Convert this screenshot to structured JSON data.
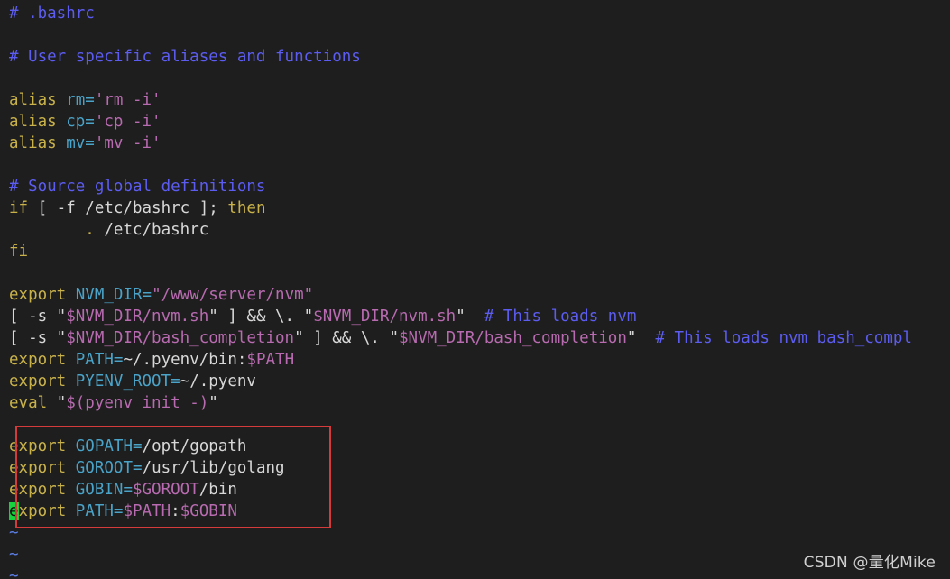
{
  "colors": {
    "background": "#1e1e1e",
    "comment": "#5c5cf0",
    "keyword": "#c9b24a",
    "variable": "#4aa3c8",
    "string": "#b86bb0",
    "text": "#d8d8d8",
    "tilde": "#5c7fe8",
    "cursor": "#18d23d",
    "highlight_box": "#d63b3b"
  },
  "editor": {
    "lines": [
      [
        {
          "t": "# .bashrc",
          "c": "comment"
        }
      ],
      [],
      [
        {
          "t": "# User specific aliases and functions",
          "c": "comment"
        }
      ],
      [],
      [
        {
          "t": "alias",
          "c": "keyword"
        },
        {
          "t": " "
        },
        {
          "t": "rm=",
          "c": "variable"
        },
        {
          "t": "'rm -i'",
          "c": "string"
        }
      ],
      [
        {
          "t": "alias",
          "c": "keyword"
        },
        {
          "t": " "
        },
        {
          "t": "cp=",
          "c": "variable"
        },
        {
          "t": "'cp -i'",
          "c": "string"
        }
      ],
      [
        {
          "t": "alias",
          "c": "keyword"
        },
        {
          "t": " "
        },
        {
          "t": "mv=",
          "c": "variable"
        },
        {
          "t": "'mv -i'",
          "c": "string"
        }
      ],
      [],
      [
        {
          "t": "# Source global definitions",
          "c": "comment"
        }
      ],
      [
        {
          "t": "if",
          "c": "keyword"
        },
        {
          "t": " [ -f /etc/bashrc ]; "
        },
        {
          "t": "then",
          "c": "keyword"
        }
      ],
      [
        {
          "t": "        "
        },
        {
          "t": ".",
          "c": "keyword"
        },
        {
          "t": " /etc/bashrc"
        }
      ],
      [
        {
          "t": "fi",
          "c": "keyword"
        }
      ],
      [],
      [
        {
          "t": "export",
          "c": "keyword"
        },
        {
          "t": " "
        },
        {
          "t": "NVM_DIR=",
          "c": "variable"
        },
        {
          "t": "\"/www/server/nvm\"",
          "c": "string"
        }
      ],
      [
        {
          "t": "[ -s \""
        },
        {
          "t": "$NVM_DIR/nvm.sh",
          "c": "string"
        },
        {
          "t": "\" ] && \\. \""
        },
        {
          "t": "$NVM_DIR/nvm.sh",
          "c": "string"
        },
        {
          "t": "\"  "
        },
        {
          "t": "# This loads nvm",
          "c": "comment"
        }
      ],
      [
        {
          "t": "[ -s \""
        },
        {
          "t": "$NVM_DIR/bash_completion",
          "c": "string"
        },
        {
          "t": "\" ] && \\. \""
        },
        {
          "t": "$NVM_DIR/bash_completion",
          "c": "string"
        },
        {
          "t": "\"  "
        },
        {
          "t": "# This loads nvm bash_compl",
          "c": "comment"
        }
      ],
      [
        {
          "t": "export",
          "c": "keyword"
        },
        {
          "t": " "
        },
        {
          "t": "PATH=",
          "c": "variable"
        },
        {
          "t": "~/.pyenv/bin:"
        },
        {
          "t": "$PATH",
          "c": "string"
        }
      ],
      [
        {
          "t": "export",
          "c": "keyword"
        },
        {
          "t": " "
        },
        {
          "t": "PYENV_ROOT=",
          "c": "variable"
        },
        {
          "t": "~/.pyenv"
        }
      ],
      [
        {
          "t": "eval",
          "c": "keyword"
        },
        {
          "t": " \""
        },
        {
          "t": "$(pyenv init -)",
          "c": "string"
        },
        {
          "t": "\""
        }
      ],
      [],
      [
        {
          "t": "export",
          "c": "keyword"
        },
        {
          "t": " "
        },
        {
          "t": "GOPATH=",
          "c": "variable"
        },
        {
          "t": "/opt/gopath"
        }
      ],
      [
        {
          "t": "export",
          "c": "keyword"
        },
        {
          "t": " "
        },
        {
          "t": "GOROOT=",
          "c": "variable"
        },
        {
          "t": "/usr/lib/golang"
        }
      ],
      [
        {
          "t": "export",
          "c": "keyword"
        },
        {
          "t": " "
        },
        {
          "t": "GOBIN=",
          "c": "variable"
        },
        {
          "t": "$GOROOT",
          "c": "string"
        },
        {
          "t": "/bin"
        }
      ],
      [
        {
          "t": "e",
          "c": "cursor"
        },
        {
          "t": "xport",
          "c": "keyword"
        },
        {
          "t": " "
        },
        {
          "t": "PATH=",
          "c": "variable"
        },
        {
          "t": "$PATH",
          "c": "string"
        },
        {
          "t": ":"
        },
        {
          "t": "$GOBIN",
          "c": "string"
        }
      ],
      [
        {
          "t": "~",
          "c": "tilde"
        }
      ],
      [
        {
          "t": "~",
          "c": "tilde"
        }
      ],
      [
        {
          "t": "~",
          "c": "tilde"
        }
      ]
    ]
  },
  "watermark": "CSDN @量化Mike"
}
